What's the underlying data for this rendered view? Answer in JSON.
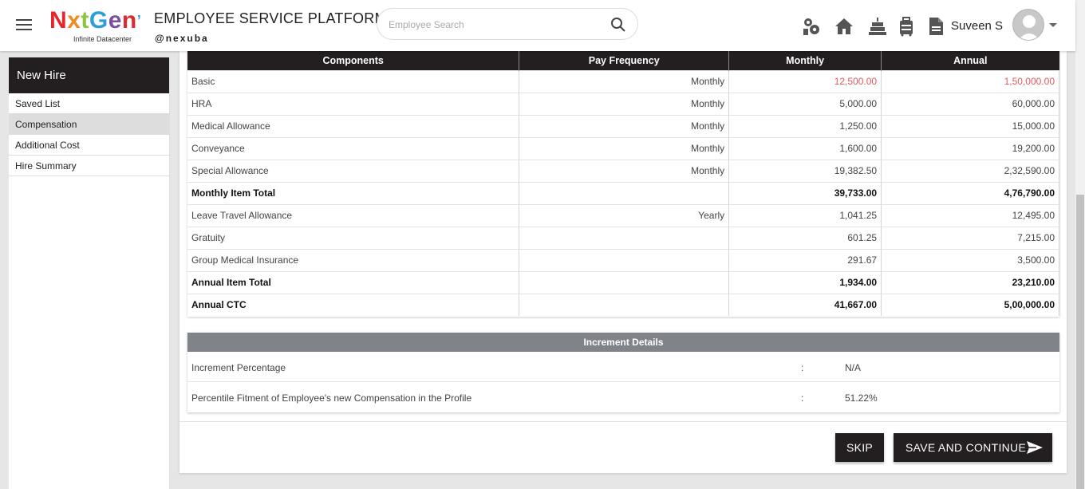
{
  "header": {
    "logo": "NxtGen",
    "logo_sub": "Infinite Datacenter",
    "title": "EMPLOYEE SERVICE PLATFORM",
    "subtitle": "@nexuba",
    "search_placeholder": "Employee Search",
    "user_name": "Suveen S"
  },
  "sidebar": {
    "heading": "New Hire",
    "items": [
      {
        "label": "Saved List"
      },
      {
        "label": "Compensation"
      },
      {
        "label": "Additional Cost"
      },
      {
        "label": "Hire Summary"
      }
    ]
  },
  "compensation": {
    "columns": [
      "Components",
      "Pay Frequency",
      "Monthly",
      "Annual"
    ],
    "rows": [
      {
        "component": "Basic",
        "frequency": "Monthly",
        "monthly": "12,500.00",
        "annual": "1,50,000.00"
      },
      {
        "component": "HRA",
        "frequency": "Monthly",
        "monthly": "5,000.00",
        "annual": "60,000.00"
      },
      {
        "component": "Medical Allowance",
        "frequency": "Monthly",
        "monthly": "1,250.00",
        "annual": "15,000.00"
      },
      {
        "component": "Conveyance",
        "frequency": "Monthly",
        "monthly": "1,600.00",
        "annual": "19,200.00"
      },
      {
        "component": "Special Allowance",
        "frequency": "Monthly",
        "monthly": "19,382.50",
        "annual": "2,32,590.00"
      },
      {
        "component": "Monthly Item Total",
        "frequency": "",
        "monthly": "39,733.00",
        "annual": "4,76,790.00"
      },
      {
        "component": "Leave Travel Allowance",
        "frequency": "Yearly",
        "monthly": "1,041.25",
        "annual": "12,495.00"
      },
      {
        "component": "Gratuity",
        "frequency": "",
        "monthly": "601.25",
        "annual": "7,215.00"
      },
      {
        "component": "Group Medical Insurance",
        "frequency": "",
        "monthly": "291.67",
        "annual": "3,500.00"
      },
      {
        "component": "Annual Item Total",
        "frequency": "",
        "monthly": "1,934.00",
        "annual": "23,210.00"
      },
      {
        "component": "Annual CTC",
        "frequency": "",
        "monthly": "41,667.00",
        "annual": "5,00,000.00"
      }
    ]
  },
  "increment": {
    "heading": "Increment Details",
    "rows": [
      {
        "label": "Increment Percentage",
        "sep": ":",
        "value": "N/A"
      },
      {
        "label": "Percentile Fitment of Employee's new Compensation in the Profile",
        "sep": ":",
        "value": "51.22%"
      }
    ]
  },
  "buttons": {
    "skip": "SKIP",
    "save": "SAVE AND CONTINUE"
  },
  "colors": {
    "dark": "#231f20",
    "highlight_red": "#e05a5a",
    "increment_header": "#808389"
  }
}
